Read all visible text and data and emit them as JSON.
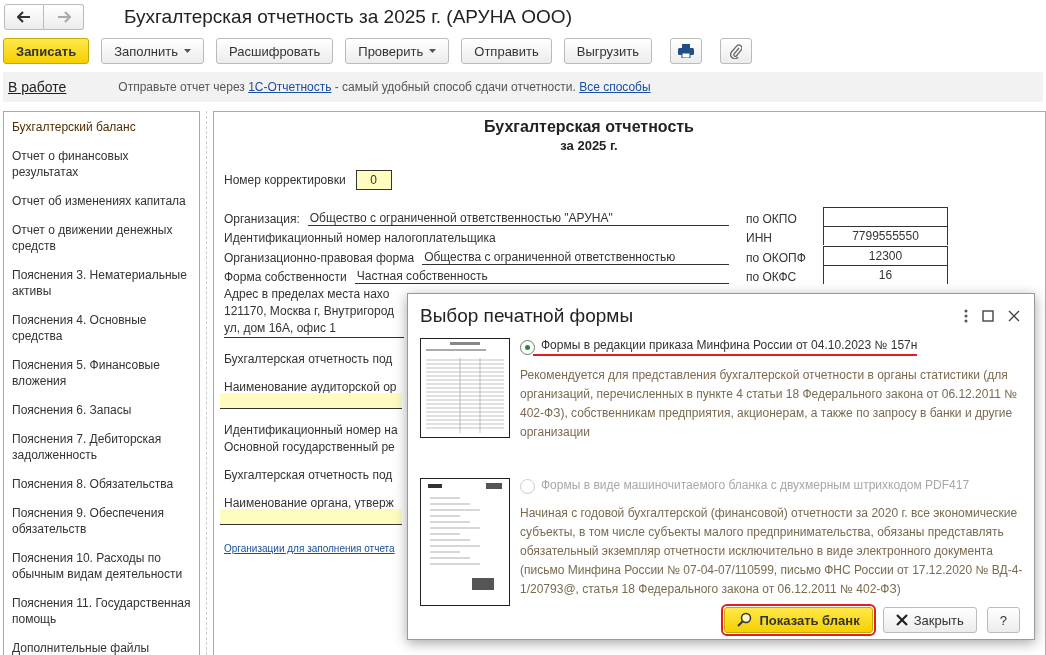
{
  "window": {
    "title": "Бухгалтерская отчетность за 2025 г. (АРУНА ООО)",
    "nav": [
      {
        "kind": "back",
        "disabled": false
      },
      {
        "kind": "forward",
        "disabled": true
      }
    ]
  },
  "toolbar": {
    "buttons": [
      {
        "label": "Записать",
        "primary": true,
        "dropdown": false
      },
      {
        "label": "Заполнить",
        "primary": false,
        "dropdown": true
      },
      {
        "label": "Расшифровать",
        "primary": false,
        "dropdown": false
      },
      {
        "label": "Проверить",
        "primary": false,
        "dropdown": true
      },
      {
        "label": "Отправить",
        "primary": false,
        "dropdown": false
      },
      {
        "label": "Выгрузить",
        "primary": false,
        "dropdown": false
      }
    ],
    "icon_buttons": [
      {
        "kind": "print"
      },
      {
        "kind": "attach"
      }
    ]
  },
  "info_bar": {
    "status": "В работе",
    "message": [
      {
        "kind": "text",
        "text": "Отправьте отчет через "
      },
      {
        "kind": "link",
        "text": "1С-Отчетность"
      },
      {
        "kind": "text",
        "text": " - самый удобный способ сдачи отчетности. "
      },
      {
        "kind": "link",
        "text": "Все способы"
      }
    ]
  },
  "sidebar": {
    "items": [
      {
        "label": "Бухгалтерский баланс",
        "selected": true
      },
      {
        "label": "Отчет о финансовых результатах",
        "selected": false
      },
      {
        "label": "Отчет об изменениях капитала",
        "selected": false
      },
      {
        "label": "Отчет о движении денежных средств",
        "selected": false
      },
      {
        "label": "Пояснения 3. Нематериальные активы",
        "selected": false
      },
      {
        "label": "Пояснения 4. Основные средства",
        "selected": false
      },
      {
        "label": "Пояснения 5. Финансовые вложения",
        "selected": false
      },
      {
        "label": "Пояснения 6. Запасы",
        "selected": false
      },
      {
        "label": "Пояснения 7. Дебиторская задолженность",
        "selected": false
      },
      {
        "label": "Пояснения 8. Обязательства",
        "selected": false
      },
      {
        "label": "Пояснения 9. Обеспечения обязательств",
        "selected": false
      },
      {
        "label": "Пояснения 10. Расходы по обычным видам деятельности",
        "selected": false
      },
      {
        "label": "Пояснения 11. Государственная помощь",
        "selected": false
      },
      {
        "label": "Дополнительные файлы",
        "selected": false
      }
    ]
  },
  "document": {
    "title": "Бухгалтерская отчетность",
    "subtitle": "за 2025 г.",
    "correction": {
      "label": "Номер корректировки",
      "value": "0"
    },
    "fields": [
      {
        "label": "Организация:",
        "value": "Общество с ограниченной ответственностью \"АРУНА\"",
        "code_label": "по ОКПО"
      },
      {
        "label": "Идентификационный номер налогоплательщика",
        "code_label": "ИНН",
        "code": "7799555550"
      },
      {
        "label": "Организационно-правовая форма",
        "value": "Общества с ограниченной ответственностью",
        "code_label": "по ОКОПФ",
        "code": "12300"
      },
      {
        "label": "Форма собственности",
        "value": "Частная собственность",
        "code_label": "по ОКФС",
        "code": "16"
      }
    ],
    "address": {
      "label": "Адрес в пределах места нахо",
      "lines": [
        "121170, Москва г, Внутригород",
        "ул, дом 16А, офис 1"
      ]
    },
    "groups": [
      [
        {
          "kind": "text",
          "label": "Бухгалтерская отчетность под"
        }
      ],
      [
        {
          "kind": "fill",
          "label": "Наименование аудиторской ор"
        }
      ],
      [
        {
          "kind": "text",
          "label": "Идентификационный номер на"
        },
        {
          "kind": "text",
          "label": "Основной государственный ре"
        }
      ],
      [
        {
          "kind": "text",
          "label": "Бухгалтерская отчетность под"
        }
      ],
      [
        {
          "kind": "fill",
          "label": "Наименование органа, утверж"
        }
      ]
    ],
    "link": "Организации для заполнения отчета"
  },
  "dialog": {
    "title": "Выбор печатной формы",
    "options": [
      {
        "kind": "table",
        "title": "Формы в редакции приказа Минфина России от 04.10.2023 № 157н",
        "selected": true,
        "disabled": false,
        "underlined": true,
        "description": "Рекомендуется для представления бухгалтерской отчетности в органы статистики (для организаций, перечисленных в пункте 4 статьи 18 Федерального закона от 06.12.2011 № 402-ФЗ), собственникам предприятия, акционерам, а также по запросу в банки и другие организации"
      },
      {
        "kind": "barcode",
        "title": "Формы в виде машиночитаемого бланка с двухмерным штрихкодом PDF417",
        "selected": false,
        "disabled": true,
        "underlined": false,
        "description": "Начиная с годовой бухгалтерской (финансовой) отчетности за 2020 г. все экономические субъекты, в том числе субъекты малого предпринимательства, обязаны представлять обязательный экземпляр отчетности исключительно в виде электронного документа (письмо Минфина России № 07-04-07/110599, письмо ФНС России от 17.12.2020 № ВД-4-1/20793@, статья 18 Федерального закона от 06.12.2011 № 402-ФЗ)"
      }
    ],
    "buttons": [
      {
        "kind": "show",
        "label": "Показать бланк",
        "highlighted": true
      },
      {
        "kind": "close",
        "label": "Закрыть",
        "highlighted": false
      },
      {
        "kind": "help",
        "label": "?",
        "highlighted": false
      }
    ]
  }
}
